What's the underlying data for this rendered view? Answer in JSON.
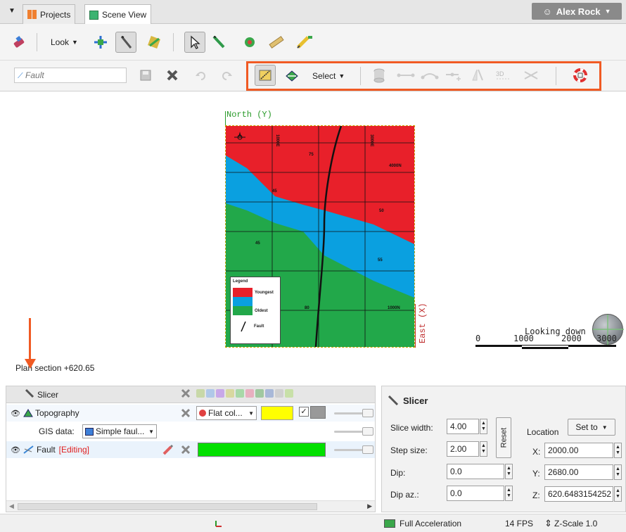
{
  "tabs": [
    {
      "label": "Projects",
      "icon": "grid-icon"
    },
    {
      "label": "Scene View",
      "icon": "cube-icon"
    }
  ],
  "user": {
    "name": "Alex Rock"
  },
  "toolbar1": {
    "look_label": "Look"
  },
  "toolbar2": {
    "fault_placeholder": "Fault",
    "select_label": "Select"
  },
  "scene": {
    "north_label": "North (Y)",
    "east_label": "East (X)",
    "plan_section": "Plan section +620.65",
    "looking_down": "Looking down",
    "scale_ticks": [
      "0",
      "1000",
      "2000",
      "3000"
    ],
    "map_labels": {
      "e1000": "1000E",
      "e3000": "3000E",
      "n4000": "4000N",
      "n1000": "1000N"
    },
    "dips": [
      "75",
      "45",
      "50",
      "45",
      "55",
      "80"
    ],
    "legend": {
      "title": "Legend",
      "youngest": "Youngest",
      "oldest": "Oldest",
      "fault": "Fault"
    },
    "colors": {
      "red": "#e8202a",
      "blue": "#0aa0e0",
      "green": "#22a84a"
    }
  },
  "objects": {
    "header": "Slicer",
    "rows": [
      {
        "label": "Topography",
        "color_mode": "Flat col..."
      },
      {
        "gis_label": "GIS data:",
        "gis_value": "Simple faul..."
      },
      {
        "label": "Fault",
        "editing": "[Editing]"
      }
    ],
    "colors": {
      "topography": "#ffff00",
      "fault": "#00e000"
    }
  },
  "slicer": {
    "title": "Slicer",
    "slice_width_label": "Slice width:",
    "slice_width": "4.00",
    "step_size_label": "Step size:",
    "step_size": "2.00",
    "reset": "Reset",
    "dip_label": "Dip:",
    "dip": "0.0",
    "dip_az_label": "Dip az.:",
    "dip_az": "0.0",
    "location_label": "Location",
    "set_to": "Set to",
    "x_label": "X:",
    "x": "2000.00",
    "y_label": "Y:",
    "y": "2680.00",
    "z_label": "Z:",
    "z": "620.6483154252"
  },
  "status": {
    "acceleration": "Full Acceleration",
    "fps": "14 FPS",
    "zscale": "Z-Scale 1.0"
  }
}
